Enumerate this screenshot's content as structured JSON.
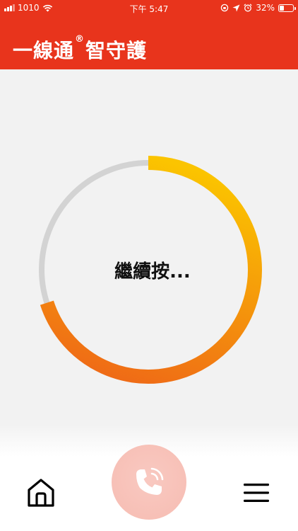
{
  "status_bar": {
    "carrier": "1010",
    "time": "下午 5:47",
    "battery": "32%",
    "battery_level": 0.32
  },
  "header": {
    "title_part1": "一線通",
    "registered_mark": "®",
    "title_part2": "智守護"
  },
  "progress": {
    "label": "繼續按...",
    "fraction": 0.7,
    "track_color": "#d3d3d3",
    "gradient_start": "#fbc400",
    "gradient_end": "#ef6b16"
  },
  "bottom_nav": {
    "home_icon": "home-icon",
    "call_icon": "phone-call-icon",
    "menu_icon": "hamburger-menu-icon"
  },
  "colors": {
    "brand_red": "#e8341c",
    "background": "#f2f2f2"
  }
}
